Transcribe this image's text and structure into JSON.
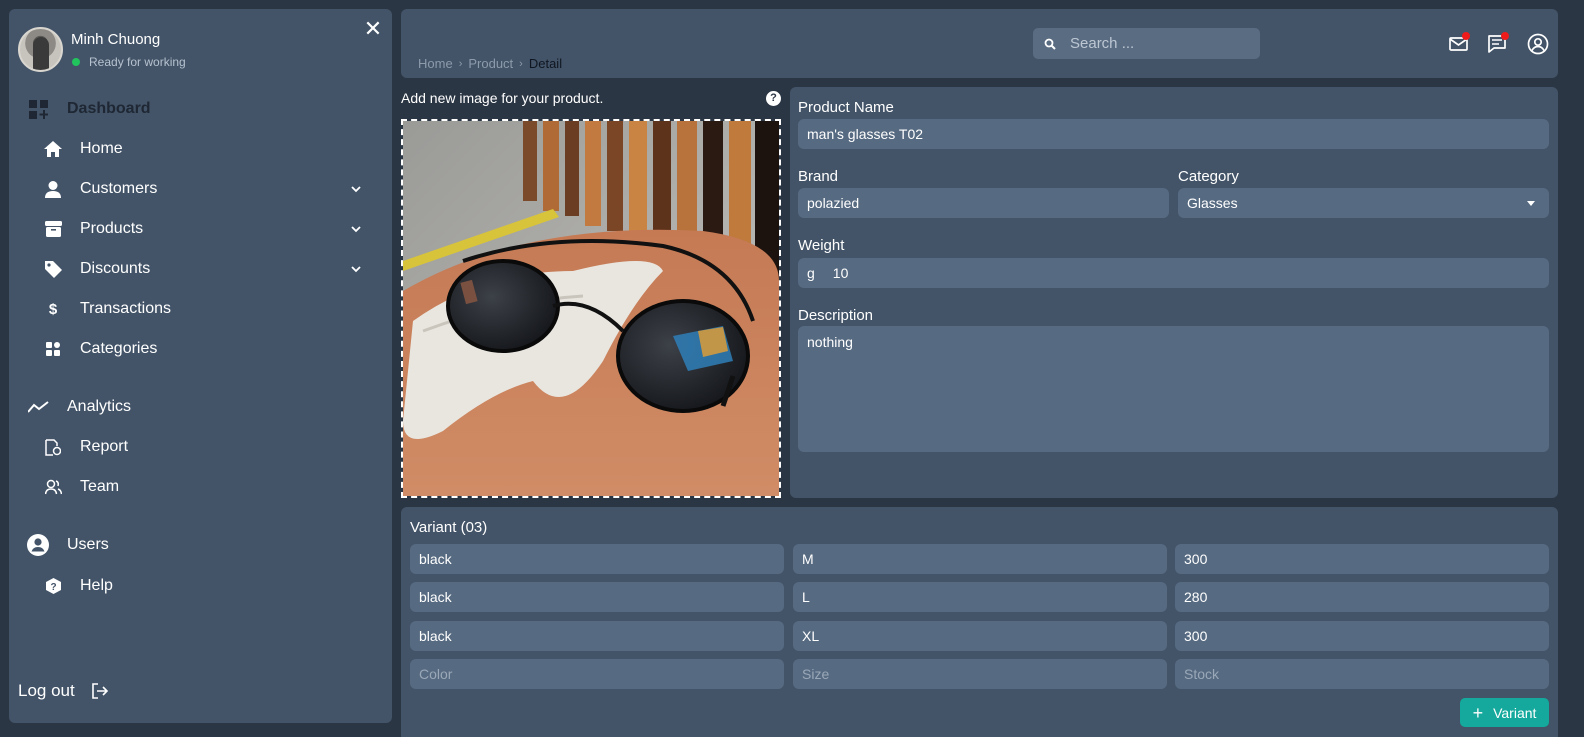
{
  "user": {
    "name": "Minh Chuong",
    "status": "Ready for working"
  },
  "sidebar": {
    "sections": [
      {
        "label": "Dashboard",
        "icon": "dashboard-icon"
      },
      {
        "label": "Analytics",
        "icon": "analytics-icon"
      },
      {
        "label": "Users",
        "icon": "user-circle-icon"
      }
    ],
    "items": [
      {
        "label": "Home",
        "icon": "home-icon"
      },
      {
        "label": "Customers",
        "icon": "person-icon"
      },
      {
        "label": "Products",
        "icon": "box-icon"
      },
      {
        "label": "Discounts",
        "icon": "tag-icon"
      },
      {
        "label": "Transactions",
        "icon": "dollar-icon"
      },
      {
        "label": "Categories",
        "icon": "grid-icon"
      },
      {
        "label": "Report",
        "icon": "report-icon"
      },
      {
        "label": "Team",
        "icon": "team-icon"
      },
      {
        "label": "Help",
        "icon": "help-icon"
      }
    ],
    "logout_label": "Log out"
  },
  "header": {
    "breadcrumb": [
      "Home",
      "Product",
      "Detail"
    ],
    "search_placeholder": "Search ..."
  },
  "image_panel": {
    "caption": "Add new image for your product.",
    "help_symbol": "?"
  },
  "form": {
    "product_name_label": "Product Name",
    "product_name": "man's glasses T02",
    "brand_label": "Brand",
    "brand": "polazied",
    "category_label": "Category",
    "category": "Glasses",
    "weight_label": "Weight",
    "weight_unit": "g",
    "weight": "10",
    "description_label": "Description",
    "description": "nothing"
  },
  "variants": {
    "title": "Variant (03)",
    "rows": [
      {
        "color": "black",
        "size": "M",
        "stock": "300"
      },
      {
        "color": "black",
        "size": "L",
        "stock": "280"
      },
      {
        "color": "black",
        "size": "XL",
        "stock": "300"
      }
    ],
    "placeholders": {
      "color": "Color",
      "size": "Size",
      "stock": "Stock"
    },
    "add_label": "Variant"
  },
  "colors": {
    "background": "#2b3644",
    "panel": "#435468",
    "input": "#566a81",
    "accent": "#14a99c",
    "status_online": "#21c45d",
    "badge": "#ef1b1b"
  }
}
